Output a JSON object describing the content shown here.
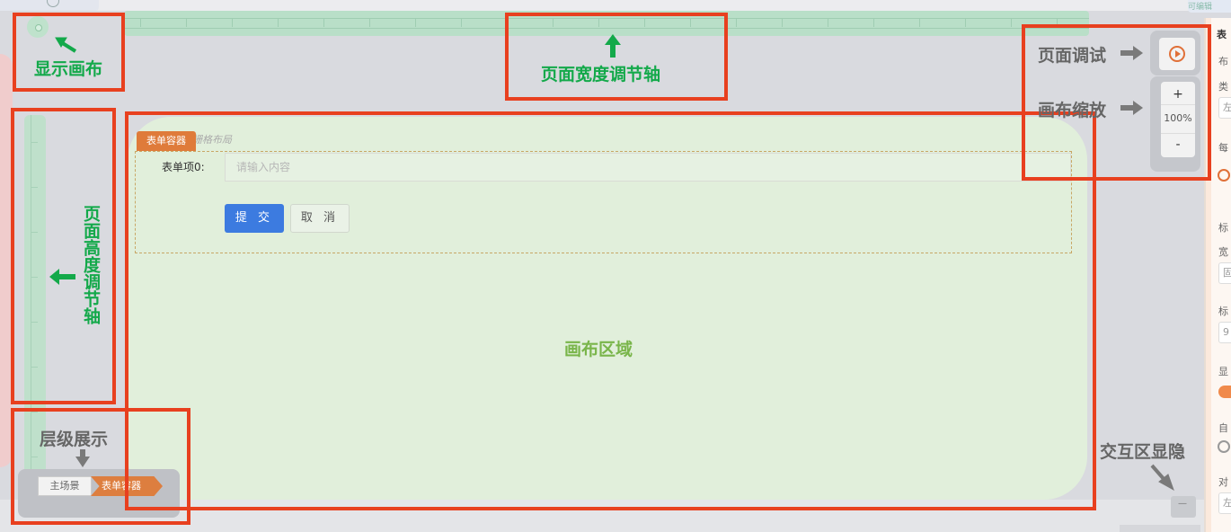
{
  "annotations": {
    "show_canvas": "显示画布",
    "page_width_ruler": "页面宽度调节轴",
    "page_debug": "页面调试",
    "canvas_zoom": "画布缩放",
    "page_height_ruler": "页面高度调节轴",
    "canvas_area": "画布区域",
    "hierarchy": "层级展示",
    "interaction_toggle": "交互区显隐"
  },
  "canvas": {
    "ghost_label": "栅格布局",
    "form_tag": "表单容器",
    "form_item_label": "表单项0:",
    "form_item_placeholder": "请输入内容",
    "submit_label": "提 交",
    "cancel_label": "取 消"
  },
  "breadcrumb": {
    "items": [
      "主场景",
      "表单容器"
    ]
  },
  "zoom": {
    "plus": "+",
    "percent": "100%",
    "minus": "-"
  },
  "props_panel": {
    "labels": [
      "表",
      "布",
      "类",
      "每",
      "标",
      "宽",
      "标",
      "显",
      "自",
      "对"
    ],
    "fields": [
      "左",
      "固",
      "9",
      "左"
    ]
  },
  "top_right_tab": "可编辑",
  "colors": {
    "annotation_red": "#e8401f",
    "green_text": "#13a94a",
    "canvas_green": "#e1efdb",
    "accent_orange": "#df7b3a",
    "primary_blue": "#3c7be0"
  }
}
